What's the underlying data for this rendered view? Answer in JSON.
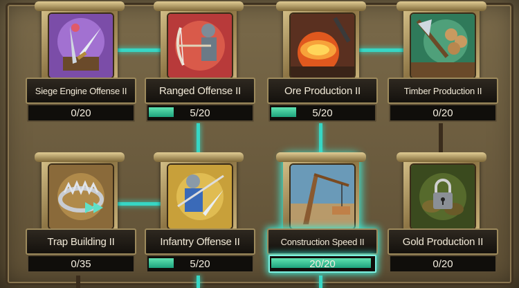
{
  "colors": {
    "connector_active": "#37d6c4",
    "progress_fill": "#2bbf8c",
    "highlight": "#41e6d2"
  },
  "skills": [
    {
      "name": "Siege Engine Offense II",
      "progress_text": "0/20",
      "current": 0,
      "max": 20,
      "icon": "siege-engine-sword-icon"
    },
    {
      "name": "Ranged Offense II",
      "progress_text": "5/20",
      "current": 5,
      "max": 20,
      "icon": "archer-icon"
    },
    {
      "name": "Ore Production II",
      "progress_text": "5/20",
      "current": 5,
      "max": 20,
      "icon": "ore-forge-icon"
    },
    {
      "name": "Timber Production II",
      "progress_text": "0/20",
      "current": 0,
      "max": 20,
      "icon": "timber-axe-icon"
    },
    {
      "name": "Trap Building II",
      "progress_text": "0/35",
      "current": 0,
      "max": 35,
      "icon": "bear-trap-icon"
    },
    {
      "name": "Infantry Offense II",
      "progress_text": "5/20",
      "current": 5,
      "max": 20,
      "icon": "infantry-soldier-icon"
    },
    {
      "name": "Construction Speed II",
      "progress_text": "20/20",
      "current": 20,
      "max": 20,
      "icon": "construction-crane-icon",
      "highlighted": true
    },
    {
      "name": "Gold Production II",
      "progress_text": "0/20",
      "current": 0,
      "max": 20,
      "icon": "locked-gold-icon",
      "locked": true
    }
  ]
}
